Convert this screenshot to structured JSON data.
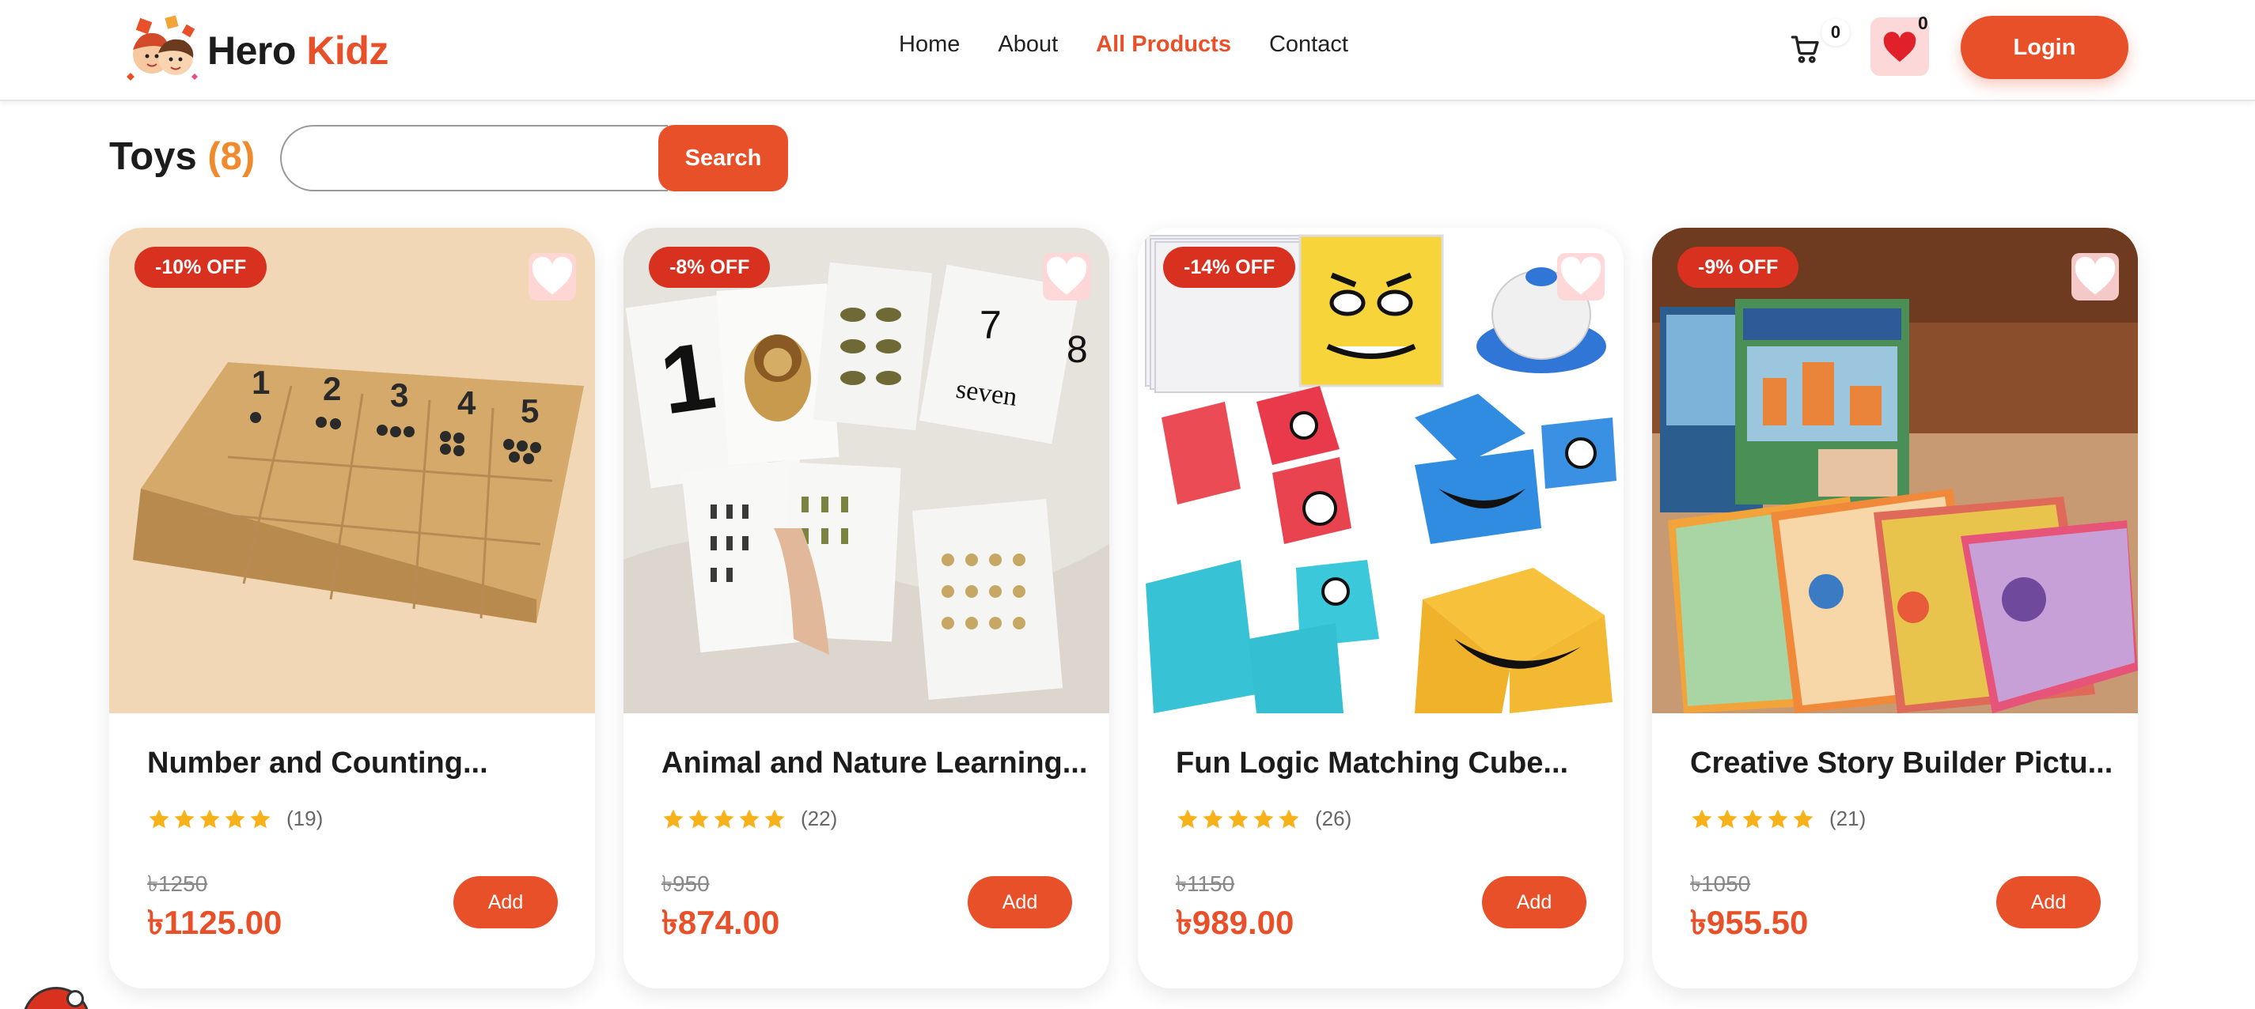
{
  "brand": {
    "name_part1": "Hero",
    "name_part2": "Kidz"
  },
  "nav": {
    "items": [
      {
        "label": "Home",
        "active": false
      },
      {
        "label": "About",
        "active": false
      },
      {
        "label": "All Products",
        "active": true
      },
      {
        "label": "Contact",
        "active": false
      }
    ]
  },
  "header": {
    "cart_count": "0",
    "wishlist_count": "0",
    "login_label": "Login"
  },
  "toolbar": {
    "title": "Toys",
    "count": "(8)",
    "search_placeholder": "",
    "search_label": "Search"
  },
  "colors": {
    "accent": "#e8502a",
    "badge": "#d9311f",
    "count": "#ef8a2d",
    "star": "#f6b11b"
  },
  "products": [
    {
      "discount": "-10% OFF",
      "title": "Number and Counting...",
      "rating": 5,
      "reviews": "(19)",
      "old_price": "৳1250",
      "price": "৳1125.00",
      "add_label": "Add",
      "image_icon": "wooden-counting-board"
    },
    {
      "discount": "-8% OFF",
      "title": "Animal and Nature Learning...",
      "rating": 5,
      "reviews": "(22)",
      "old_price": "৳950",
      "price": "৳874.00",
      "add_label": "Add",
      "image_icon": "animal-flash-cards"
    },
    {
      "discount": "-14% OFF",
      "title": "Fun Logic Matching Cube...",
      "rating": 5,
      "reviews": "(26)",
      "old_price": "৳1150",
      "price": "৳989.00",
      "add_label": "Add",
      "image_icon": "face-cube-game"
    },
    {
      "discount": "-9% OFF",
      "title": "Creative Story Builder Pictu...",
      "rating": 5,
      "reviews": "(21)",
      "old_price": "৳1050",
      "price": "৳955.50",
      "add_label": "Add",
      "image_icon": "story-picture-cards"
    }
  ]
}
